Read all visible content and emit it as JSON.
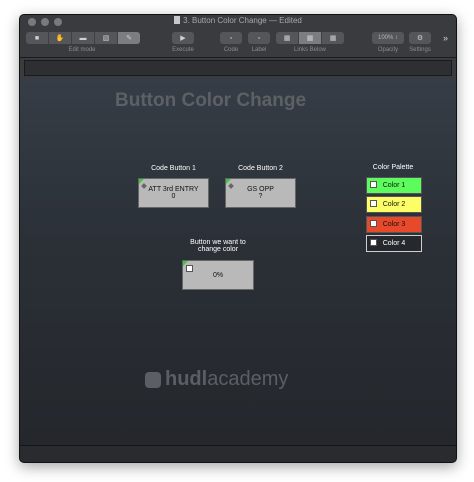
{
  "window": {
    "title": "3. Button Color Change — Edited"
  },
  "toolbar": {
    "edit_mode_label": "Edit mode",
    "execute_label": "Execute",
    "code_label": "Code",
    "label_label": "Label",
    "links_below_label": "Links Below",
    "opacity_label": "Opacity",
    "opacity_value": "100% ↕",
    "settings_label": "Settings",
    "more_glyph": "»"
  },
  "canvas": {
    "heading": "Button Color Change",
    "code_button_1": {
      "label": "Code Button 1",
      "line1": "ATT 3rd ENTRY",
      "line2": "0"
    },
    "code_button_2": {
      "label": "Code Button 2",
      "line1": "GS OPP",
      "line2": "?"
    },
    "target": {
      "label_line1": "Button we want to",
      "label_line2": "change color",
      "value": "0%"
    },
    "palette": {
      "label": "Color Palette",
      "items": [
        {
          "label": "Color 1",
          "color": "#5dfc5d"
        },
        {
          "label": "Color 2",
          "color": "#fdfd66"
        },
        {
          "label": "Color 3",
          "color": "#e7492b"
        },
        {
          "label": "Color 4",
          "color": "#25282d"
        }
      ]
    },
    "logo": {
      "part1": "hudl",
      "part2": "academy"
    }
  },
  "colors": {
    "accent_green": "#3fc93f",
    "button_gray": "#b9b9b9"
  }
}
